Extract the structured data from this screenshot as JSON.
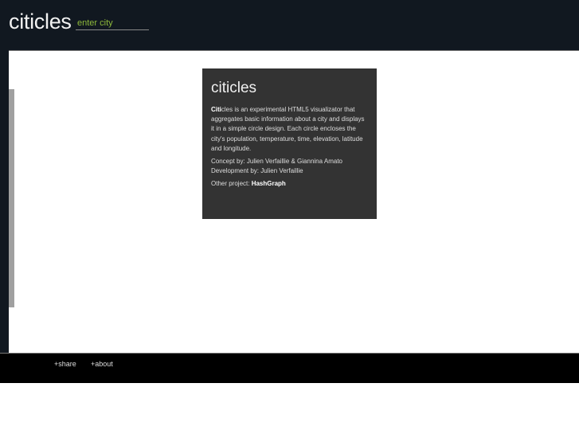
{
  "header": {
    "logo": "citicles",
    "city_input": {
      "placeholder": "enter city",
      "value": ""
    }
  },
  "about": {
    "title": "citicles",
    "desc_bold": "Citi",
    "desc_rest": "cles is an experimental HTML5 visualizator that aggregates basic information about a city and displays it in a simple circle design. Each circle encloses the city's population, temperature, time, elevation, latitude and longitude.",
    "concept": "Concept by: Julien Verfaillie & Giannina Amato",
    "development": "Development by: Julien Verfaillie",
    "other_label": "Other project: ",
    "other_link": "HashGraph"
  },
  "footer": {
    "share": "+share",
    "about": "+about"
  }
}
